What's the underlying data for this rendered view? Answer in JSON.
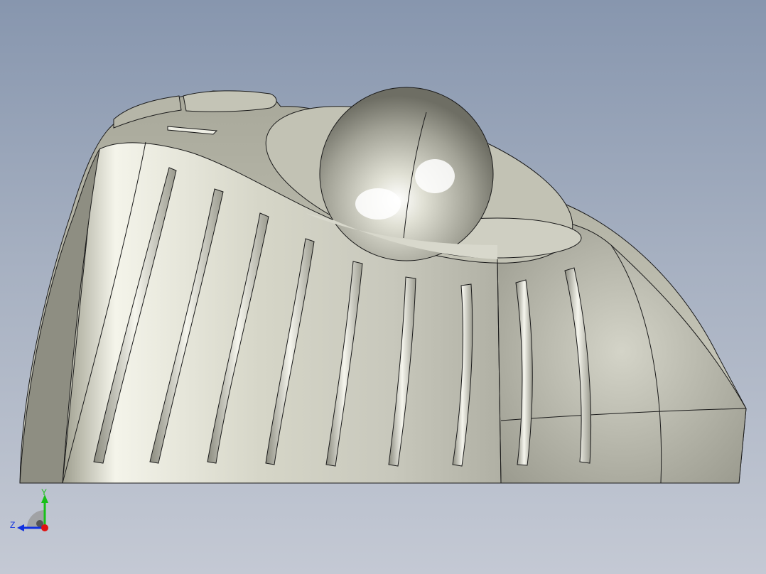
{
  "view": {
    "background_top": "#8796ae",
    "background_bottom": "#c4c9d4",
    "model_color": "#d8d8cc"
  },
  "triad": {
    "y_label": "Y",
    "z_label": "Z",
    "x_color": "#e01010",
    "y_color": "#18c018",
    "z_color": "#1030e0"
  }
}
